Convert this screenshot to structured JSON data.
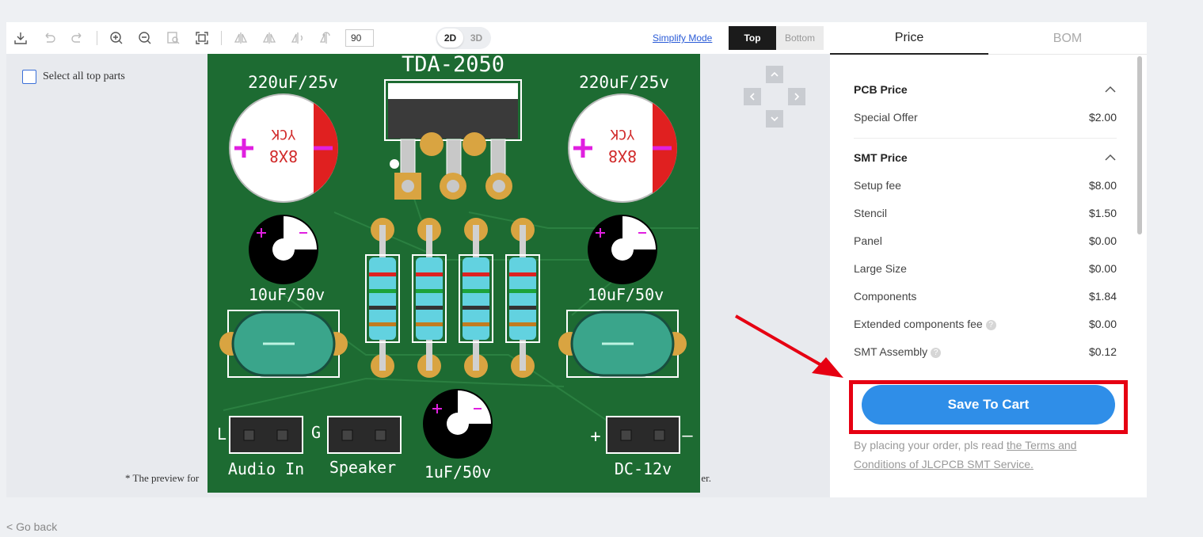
{
  "toolbar": {
    "rotation_value": "90",
    "dim_2d": "2D",
    "dim_3d": "3D",
    "simplify_mode": "Simplify Mode",
    "side_top": "Top",
    "side_bottom": "Bottom"
  },
  "viewer": {
    "select_all_label": "Select all top parts",
    "preview_note_start": "* The preview for",
    "preview_note_end": "er."
  },
  "pcb": {
    "colors": {
      "board": "#1d6b32",
      "silk": "#ffffff",
      "pad": "#d9a441",
      "cap_band": "#e02020",
      "polarity": "#e020e0"
    },
    "labels": {
      "ic": "TDA-2050",
      "cap_left": "220uF/25v",
      "cap_right": "220uF/25v",
      "cap_mark_top": "YCK",
      "cap_mark_bottom": "8X8",
      "small_cap_left": "10uF/50v",
      "small_cap_right": "10uF/50v",
      "small_cap_bottom": "1uF/50v",
      "connector_audio": "Audio In",
      "connector_speaker": "Speaker",
      "connector_dc": "DC-12v",
      "pin_l": "L",
      "pin_g": "G",
      "pin_plus": "+",
      "pin_minus": "–",
      "cap_plus": "+"
    }
  },
  "panel": {
    "tabs": [
      {
        "label": "Price",
        "active": true
      },
      {
        "label": "BOM",
        "active": false
      }
    ],
    "pcb_price": {
      "title": "PCB Price",
      "rows": [
        {
          "label": "Special Offer",
          "value": "$2.00"
        }
      ]
    },
    "smt_price": {
      "title": "SMT Price",
      "rows": [
        {
          "label": "Setup fee",
          "value": "$8.00"
        },
        {
          "label": "Stencil",
          "value": "$1.50"
        },
        {
          "label": "Panel",
          "value": "$0.00"
        },
        {
          "label": "Large Size",
          "value": "$0.00"
        },
        {
          "label": "Components",
          "value": "$1.84"
        },
        {
          "label": "Extended components fee",
          "value": "$0.00"
        },
        {
          "label": "SMT Assembly",
          "value": "$0.12"
        }
      ]
    },
    "save_to_cart": "Save To Cart",
    "terms_prefix": "By placing your order, pls read ",
    "terms_link": "the Terms and Conditions of JLCPCB SMT Service."
  },
  "footer": {
    "go_back": "< Go back"
  },
  "colors": {
    "accent": "#2f8ee8",
    "highlight": "#e60012"
  }
}
